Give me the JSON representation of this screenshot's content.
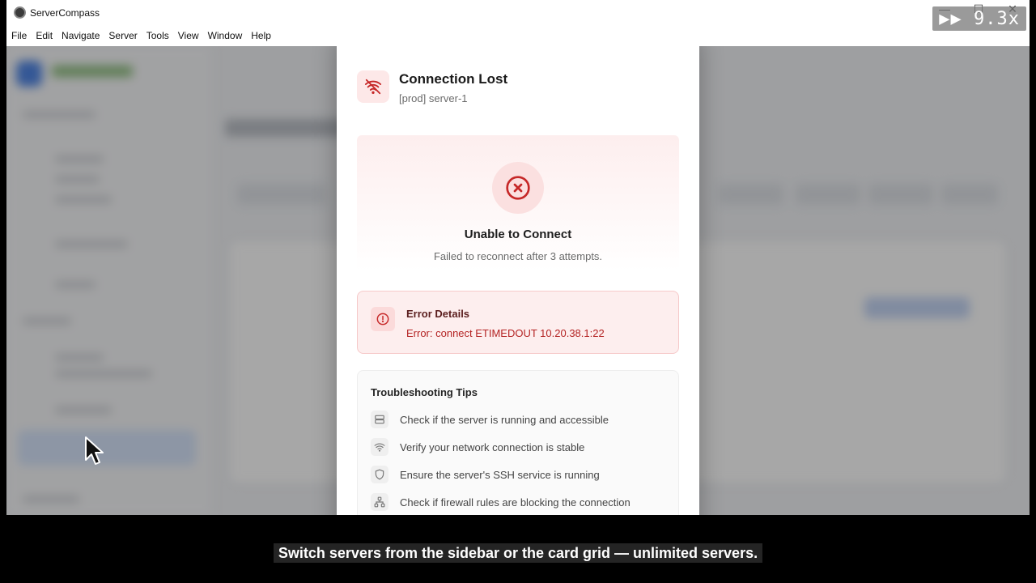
{
  "window": {
    "title": "ServerCompass",
    "controls": [
      "—",
      "☐",
      "✕"
    ]
  },
  "menu": [
    "File",
    "Edit",
    "Navigate",
    "Server",
    "Tools",
    "View",
    "Window",
    "Help"
  ],
  "modal": {
    "title": "Connection Lost",
    "subtitle": "[prod] server-1",
    "status_title": "Unable to Connect",
    "status_message": "Failed to reconnect after 3 attempts.",
    "error": {
      "title": "Error Details",
      "message": "Error: connect ETIMEDOUT 10.20.38.1:22"
    },
    "tips": {
      "title": "Troubleshooting Tips",
      "items": [
        {
          "icon": "server-icon",
          "text": "Check if the server is running and accessible"
        },
        {
          "icon": "wifi-icon",
          "text": "Verify your network connection is stable"
        },
        {
          "icon": "shield-icon",
          "text": "Ensure the server's SSH service is running"
        },
        {
          "icon": "network-icon",
          "text": "Check if firewall rules are blocking the connection"
        }
      ]
    }
  },
  "overlay": {
    "playback_speed": "▶▶ 9.3x",
    "caption": "Switch servers from the sidebar or the card grid — unlimited servers."
  },
  "colors": {
    "error_red": "#c62828",
    "error_bg": "#fdeeee",
    "accent_blue": "#2f6fe0"
  }
}
